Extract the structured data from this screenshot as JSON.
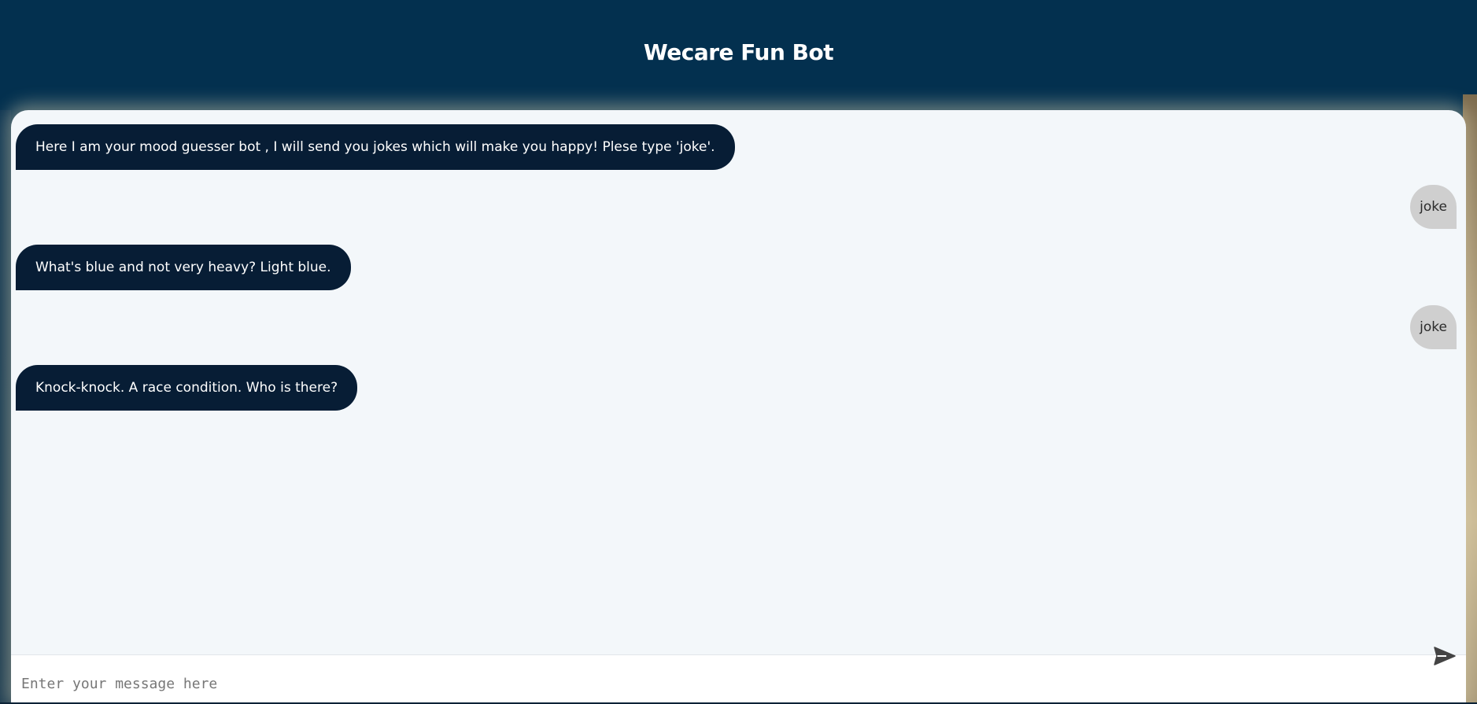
{
  "header": {
    "title": "Wecare Fun Bot"
  },
  "messages": [
    {
      "sender": "bot",
      "text": "Here I am your mood guesser bot , I will send you jokes which will make you happy! Plese type 'joke'."
    },
    {
      "sender": "user",
      "text": "joke"
    },
    {
      "sender": "bot",
      "text": "What's blue and not very heavy? Light blue."
    },
    {
      "sender": "user",
      "text": "joke"
    },
    {
      "sender": "bot",
      "text": "Knock-knock. A race condition. Who is there?"
    }
  ],
  "composer": {
    "placeholder": "Enter your message here",
    "value": ""
  },
  "icons": {
    "send": "send-icon"
  },
  "colors": {
    "header_bg": "#03304f",
    "bot_bubble": "#071d35",
    "user_bubble": "#cfcfcf",
    "chat_bg": "#f3f7fa"
  }
}
